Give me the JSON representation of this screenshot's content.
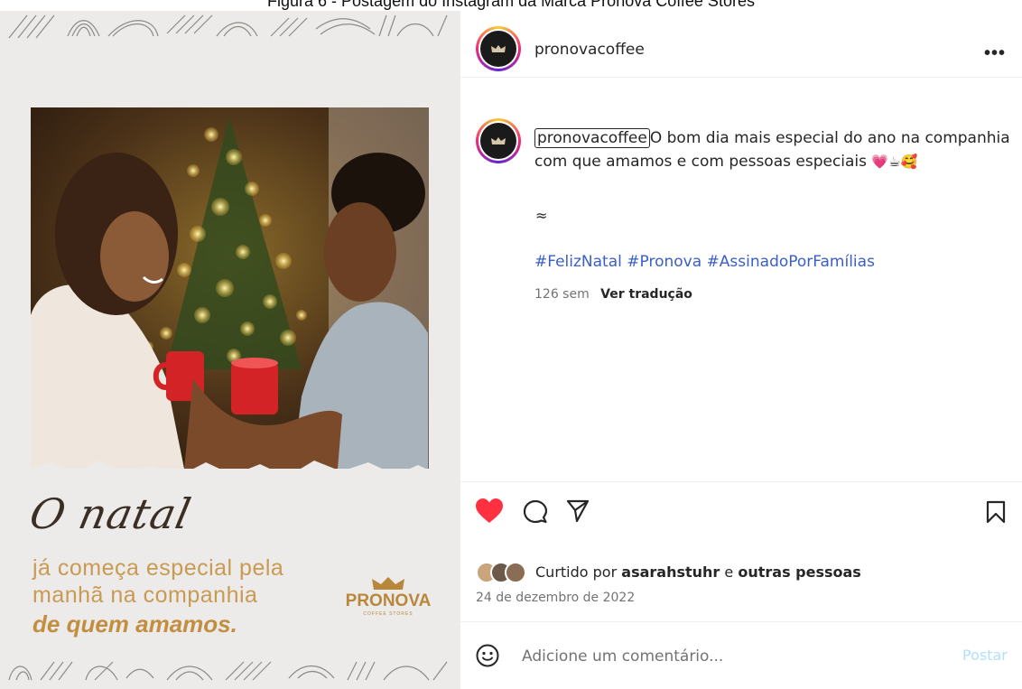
{
  "figure_caption": "Figura 6 - Postagem do Instagram da Marca Pronova Coffee Stores",
  "post_image": {
    "script_title": "O natal",
    "tagline_line1": "já começa especial pela",
    "tagline_line2": "manhã na companhia",
    "tagline_line3": "de quem amamos.",
    "brand_name": "PRONOVA",
    "brand_sub": "COFFEE STORES"
  },
  "header": {
    "username": "pronovacoffee",
    "more_label": "•••"
  },
  "caption": {
    "username": "pronovacoffee",
    "text": "O bom dia mais especial do ano na companhia com que amamos e com pessoas especiais",
    "emojis": "💗☕🥰",
    "approx": "≈",
    "hashtags": [
      "#FelizNatal",
      "#Pronova",
      "#AssinadoPorFamílias"
    ],
    "age": "126 sem",
    "see_translation": "Ver tradução"
  },
  "likes": {
    "prefix": "Curtido por",
    "user": "asarahstuhr",
    "connector": "e",
    "others": "outras pessoas"
  },
  "post_date": "24 de dezembro de 2022",
  "comment_box": {
    "placeholder": "Adicione um comentário...",
    "post_label": "Postar"
  },
  "colors": {
    "like_red": "#ff3040",
    "hashtag_blue": "#3a5fc6",
    "post_disabled": "#b2dffc",
    "gold": "#c99a52"
  }
}
